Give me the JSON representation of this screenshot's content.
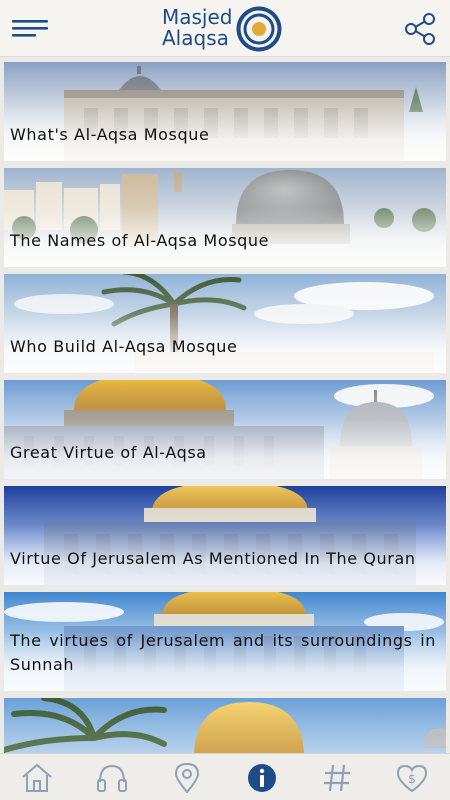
{
  "header": {
    "logo_line1": "Masjed",
    "logo_line2": "Alaqsa",
    "brand_color": "#1d4c86",
    "accent_color": "#e3a83a"
  },
  "cards": [
    {
      "title": "What's Al-Aqsa Mosque",
      "scene": "mosque-gray-dome"
    },
    {
      "title": "The Names of Al-Aqsa Mosque",
      "scene": "city-dome"
    },
    {
      "title": "Who Build Al-Aqsa Mosque",
      "scene": "palm-sky"
    },
    {
      "title": "Great Virtue of Al-Aqsa",
      "scene": "golden-and-gray-domes"
    },
    {
      "title": "Virtue Of Jerusalem As Mentioned In The Quran",
      "scene": "dome-of-rock-blue"
    },
    {
      "title": "The virtues of Jerusalem and its surroundings in Sunnah",
      "scene": "dome-of-rock-sky"
    },
    {
      "title": "",
      "scene": "palm-golden-dome"
    }
  ],
  "tabbar": {
    "items": [
      "home-icon",
      "headphones-icon",
      "location-pin-icon",
      "info-icon",
      "hashtag-icon",
      "heart-dollar-icon"
    ],
    "active": "info-icon",
    "icon_color": "#8ea2b5",
    "active_color": "#1d4c86"
  }
}
